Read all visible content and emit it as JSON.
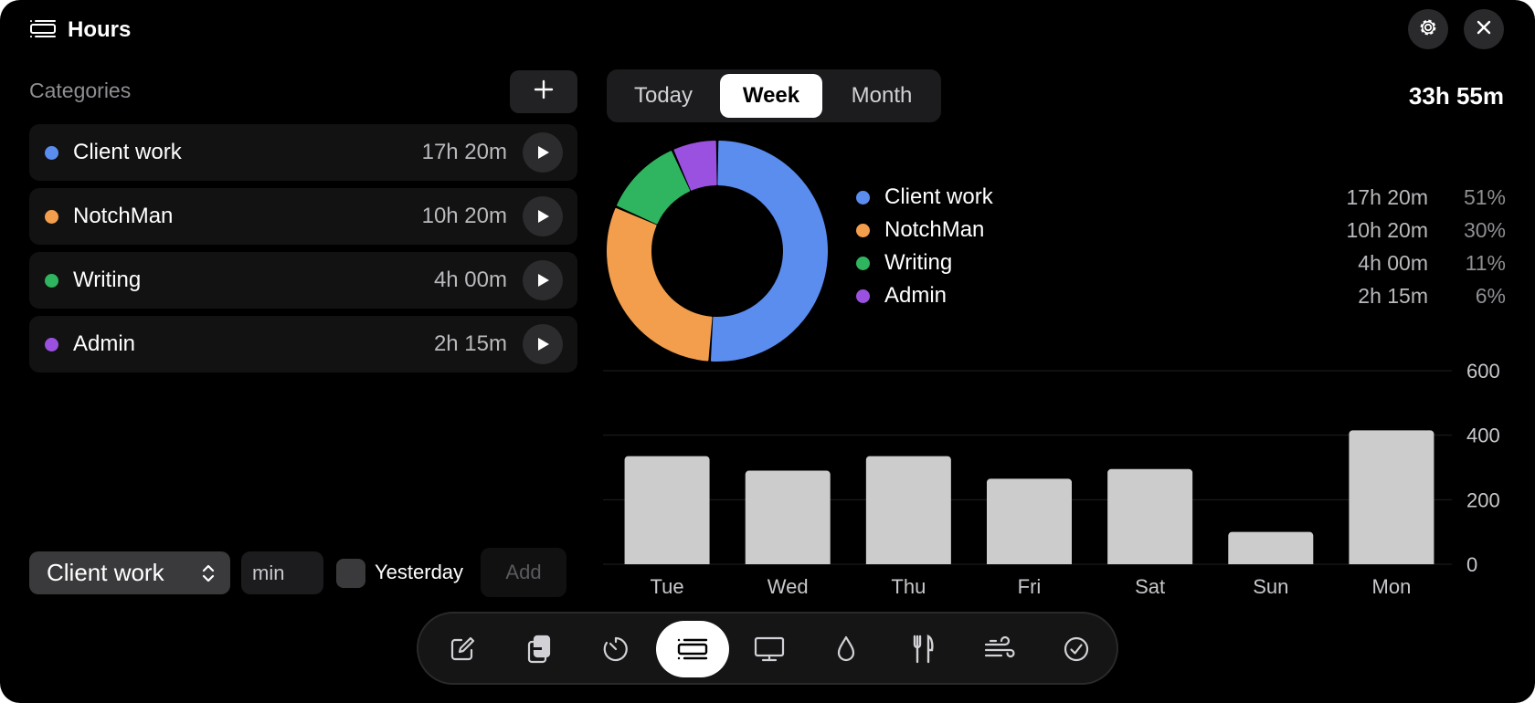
{
  "header": {
    "title": "Hours",
    "settings_icon": "gear-icon",
    "close_icon": "close-icon"
  },
  "categories": {
    "label": "Categories",
    "add_icon": "plus-icon",
    "items": [
      {
        "name": "Client work",
        "time": "17h 20m",
        "color": "#5b8def"
      },
      {
        "name": "NotchMan",
        "time": "10h 20m",
        "color": "#f29e4c"
      },
      {
        "name": "Writing",
        "time": "4h 00m",
        "color": "#2fb45f"
      },
      {
        "name": "Admin",
        "time": "2h 15m",
        "color": "#9b51e0"
      }
    ]
  },
  "entry_form": {
    "category_selected": "Client work",
    "minutes_placeholder": "min",
    "yesterday_label": "Yesterday",
    "yesterday_checked": false,
    "add_label": "Add"
  },
  "period_tabs": {
    "items": [
      "Today",
      "Week",
      "Month"
    ],
    "active": "Week"
  },
  "total": "33h 55m",
  "legend": [
    {
      "name": "Client work",
      "time": "17h 20m",
      "percent": "51%",
      "color": "#5b8def"
    },
    {
      "name": "NotchMan",
      "time": "10h 20m",
      "percent": "30%",
      "color": "#f29e4c"
    },
    {
      "name": "Writing",
      "time": "4h 00m",
      "percent": "11%",
      "color": "#2fb45f"
    },
    {
      "name": "Admin",
      "time": "2h 15m",
      "percent": "6%",
      "color": "#9b51e0"
    }
  ],
  "chart_data": [
    {
      "type": "pie",
      "categories": [
        "Client work",
        "NotchMan",
        "Writing",
        "Admin"
      ],
      "values": [
        1040,
        620,
        240,
        135
      ],
      "colors": [
        "#5b8def",
        "#f29e4c",
        "#2fb45f",
        "#9b51e0"
      ]
    },
    {
      "type": "bar",
      "categories": [
        "Tue",
        "Wed",
        "Thu",
        "Fri",
        "Sat",
        "Sun",
        "Mon"
      ],
      "values": [
        335,
        290,
        335,
        265,
        295,
        100,
        415
      ],
      "ylim": [
        0,
        600
      ],
      "yticks": [
        0,
        200,
        400,
        600
      ],
      "bar_color": "#cccccc",
      "grid": true
    }
  ],
  "dock": {
    "items": [
      {
        "icon": "compose-icon",
        "active": false
      },
      {
        "icon": "clipboard-icon",
        "active": false
      },
      {
        "icon": "timer-icon",
        "active": false
      },
      {
        "icon": "hours-list-icon",
        "active": true
      },
      {
        "icon": "display-icon",
        "active": false
      },
      {
        "icon": "water-drop-icon",
        "active": false
      },
      {
        "icon": "fork-knife-icon",
        "active": false
      },
      {
        "icon": "wind-icon",
        "active": false
      },
      {
        "icon": "checkmark-circle-icon",
        "active": false
      }
    ]
  }
}
